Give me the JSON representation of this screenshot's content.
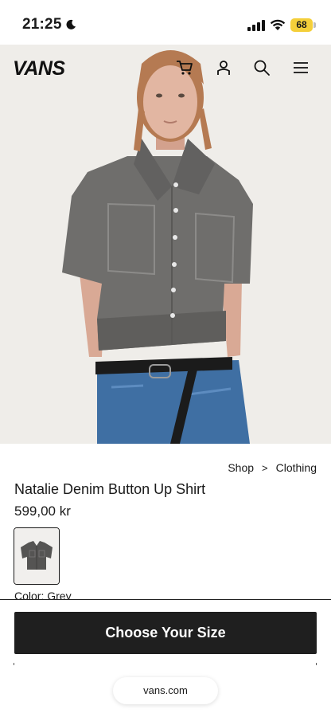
{
  "status_bar": {
    "time": "21:25",
    "battery_level": "68",
    "icons": [
      "moon-icon",
      "cellular-signal-icon",
      "wifi-icon",
      "battery-icon"
    ],
    "battery_color": "#f4cf3a"
  },
  "header": {
    "logo_text": "VANS",
    "icons": [
      "cart-icon",
      "account-icon",
      "search-icon",
      "menu-icon"
    ]
  },
  "breadcrumb": {
    "items": [
      "Shop",
      "Clothing"
    ],
    "separator": ">"
  },
  "product": {
    "title": "Natalie Denim Button Up Shirt",
    "price": "599,00 kr",
    "color_label": "Color: Grey"
  },
  "cta": {
    "label": "Choose Your Size",
    "background": "#1f1f1f"
  },
  "browser": {
    "url": "vans.com"
  }
}
